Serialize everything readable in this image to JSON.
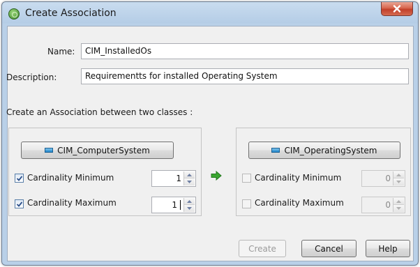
{
  "window": {
    "title": "Create Association",
    "app_icon": "association-app-icon",
    "close_icon": "close-icon"
  },
  "form": {
    "name_label": "Name:",
    "name_value": "CIM_InstalledOs",
    "description_label": "Description:",
    "description_value": "Requirementts for installed Operating System",
    "association_prompt": "Create an Association between two classes :"
  },
  "left_class": {
    "button_label": "CIM_ComputerSystem",
    "icon": "class-icon",
    "cardinality_min": {
      "label": "Cardinality Minimum",
      "checked": true,
      "value": "1",
      "enabled": true
    },
    "cardinality_max": {
      "label": "Cardinality Maximum",
      "checked": true,
      "value": "1",
      "enabled": true
    }
  },
  "link_arrow_icon": "arrow-right-icon",
  "right_class": {
    "button_label": "CIM_OperatingSystem",
    "icon": "class-icon",
    "cardinality_min": {
      "label": "Cardinality Minimum",
      "checked": false,
      "value": "0",
      "enabled": false
    },
    "cardinality_max": {
      "label": "Cardinality Maximum",
      "checked": false,
      "value": "0",
      "enabled": false
    }
  },
  "buttons": {
    "create": "Create",
    "cancel": "Cancel",
    "help": "Help"
  },
  "colors": {
    "titlebar": "#b9d0e8",
    "close_button": "#c2402a",
    "client_bg": "#f0f0f0",
    "arrow": "#3aa630"
  }
}
